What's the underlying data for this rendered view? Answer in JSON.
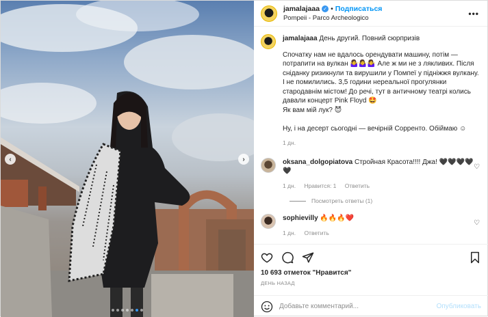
{
  "post": {
    "username": "jamalajaaa",
    "follow_label": "Подписаться",
    "location": "Pompeii - Parco Archeologico",
    "more_label": "•••"
  },
  "caption": {
    "title": "День другий. Повний сюрпризів",
    "text": "Спочатку нам не вдалось орендувати машину, потім — потрапити на вулкан 🤷‍♀️🤷‍♀️🤷‍♀️ Але ж ми не з лякливих. Після сніданку ризикнули та вирушили у Помпеї у підніжжя вулкану. І не помилились. 3,5 години нереальної прогулянки стародавнім містом! До речі, тут в античному театрі колись давали концерт Pink Floyd 🤩\nЯк вам мій лук? 😈\n\nНу, і на десерт сьогодні — вечірній Сорренто. Обіймаю ☺",
    "time": "1 дн."
  },
  "comments": [
    {
      "username": "oksana_dolgopiatova",
      "text": "Стройная Красота!!!! Джа! 🖤🖤🖤🖤🖤",
      "time": "1 дн.",
      "likes": "Нравится: 1",
      "reply": "Ответить"
    },
    {
      "username": "sophievilly",
      "text": "🔥🔥🔥❤️",
      "time": "1 дн.",
      "reply": "Ответить"
    }
  ],
  "view_replies": "Посмотреть ответы (1)",
  "likes_count": "10 693 отметок \"Нравится\"",
  "date": "ДЕНЬ НАЗАД",
  "add_comment": {
    "placeholder": "Добавьте комментарий...",
    "publish": "Опубликовать"
  },
  "carousel": {
    "total": 7,
    "active": 6
  },
  "colors": {
    "accent": "#0095f6",
    "muted": "#8e8e8e",
    "text": "#262626"
  }
}
